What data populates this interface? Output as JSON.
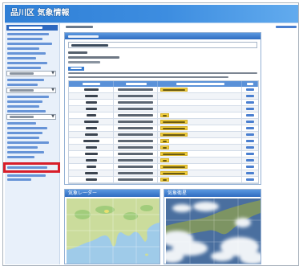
{
  "header": {
    "title": "品川区 気象情報"
  },
  "radar_panel": {
    "title": "気象レーダー"
  },
  "satellite_panel": {
    "title": "気象衛星"
  },
  "colors": {
    "header": "#2f7fd6",
    "sidebar_active": "#2d68bf",
    "link": "#4a7fd0",
    "warning_badge": "#f1cf3e",
    "annotation": "#d81e2a"
  },
  "icons": {
    "select_arrow": "chevron-down-icon"
  }
}
